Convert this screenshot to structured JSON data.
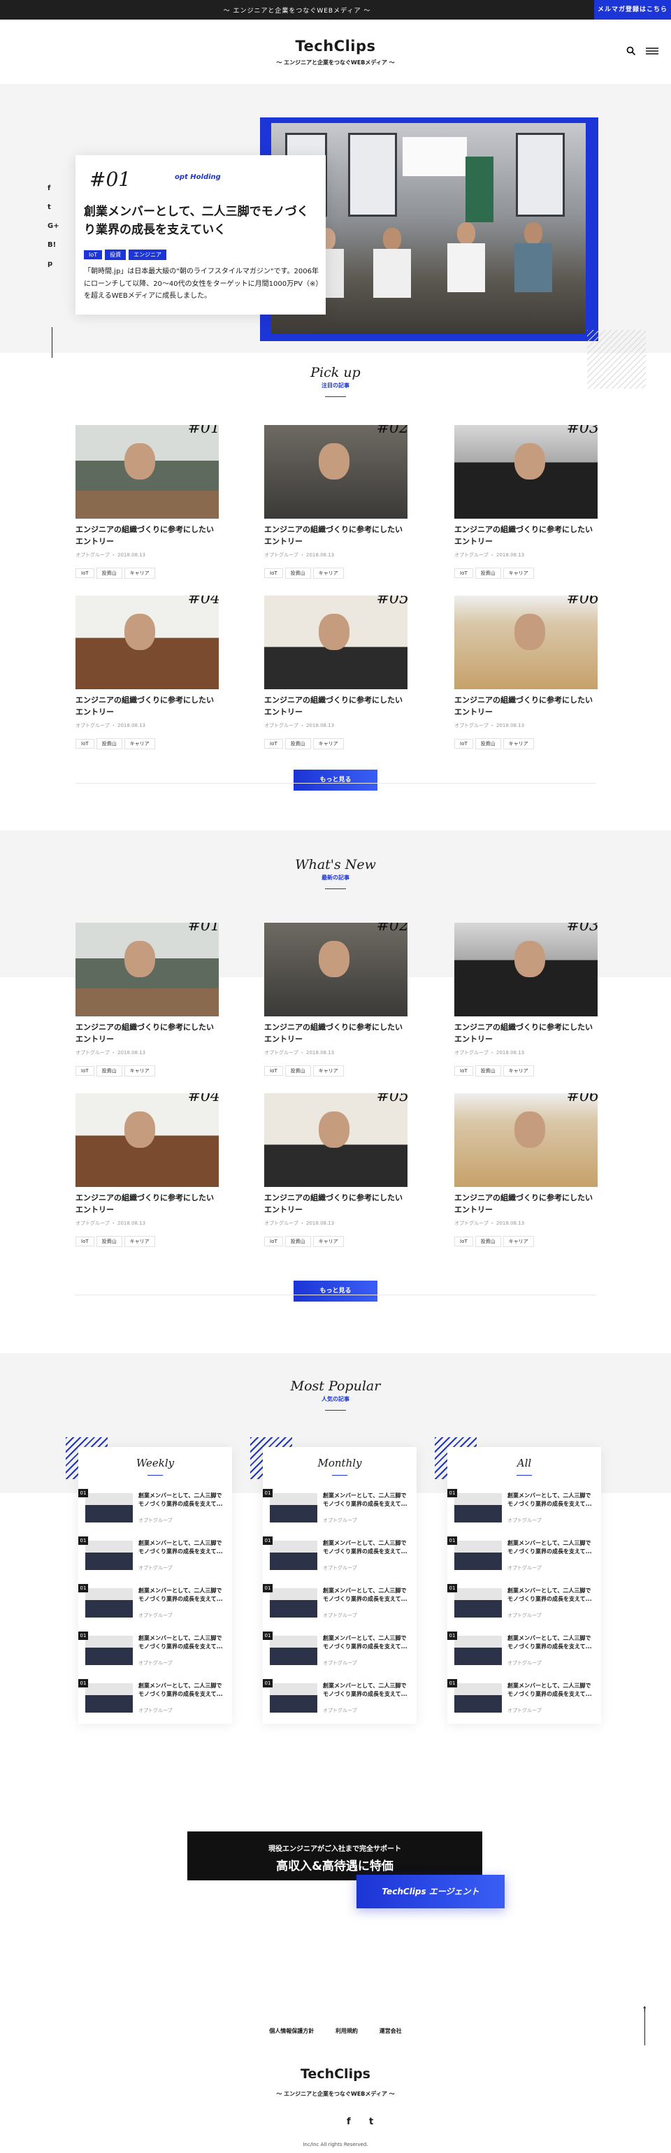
{
  "topbar": {
    "tagline": "〜 エンジニアと企業をつなぐWEBメディア 〜",
    "magazine_button": "メルマガ登録はこちら"
  },
  "header": {
    "logo": "TechClips",
    "logo_sub": "〜 エンジニアと企業をつなぐWEBメディア 〜",
    "icons": [
      "search-icon",
      "menu-icon"
    ]
  },
  "hero": {
    "number": "#01",
    "sponsor": "opt Holding",
    "title": "創業メンバーとして、二人三脚でモノづくり業界の成長を支えていく",
    "tags": [
      "IoT",
      "投資",
      "エンジニア"
    ],
    "description": "「朝時間.jp」は日本最大級の\"朝のライフスタイルマガジン\"です。2006年にローンチして以降、20～40代の女性をターゲットに月間1000万PV（※）を超えるWEBメディアに成長しました。",
    "social": [
      "f",
      "t",
      "G+",
      "B!",
      "p"
    ]
  },
  "pickup": {
    "title_en": "Pick up",
    "title_ja": "注目の記事",
    "more": "もっと見る"
  },
  "whatsnew": {
    "title_en": "What's New",
    "title_ja": "最新の記事",
    "more": "もっと見る"
  },
  "cards": [
    {
      "num": "#01",
      "title": "エンジニアの組織づくりに参考にしたいエントリー",
      "meta": "オプトグループ ・ 2018.08.13",
      "tags": [
        "IoT",
        "投資山",
        "キャリア"
      ]
    },
    {
      "num": "#02",
      "title": "エンジニアの組織づくりに参考にしたいエントリー",
      "meta": "オプトグループ ・ 2018.08.13",
      "tags": [
        "IoT",
        "投資山",
        "キャリア"
      ]
    },
    {
      "num": "#03",
      "title": "エンジニアの組織づくりに参考にしたいエントリー",
      "meta": "オプトグループ ・ 2018.08.13",
      "tags": [
        "IoT",
        "投資山",
        "キャリア"
      ]
    },
    {
      "num": "#04",
      "title": "エンジニアの組織づくりに参考にしたいエントリー",
      "meta": "オプトグループ ・ 2018.08.13",
      "tags": [
        "IoT",
        "投資山",
        "キャリア"
      ]
    },
    {
      "num": "#05",
      "title": "エンジニアの組織づくりに参考にしたいエントリー",
      "meta": "オプトグループ ・ 2018.08.13",
      "tags": [
        "IoT",
        "投資山",
        "キャリア"
      ]
    },
    {
      "num": "#06",
      "title": "エンジニアの組織づくりに参考にしたいエントリー",
      "meta": "オプトグループ ・ 2018.08.13",
      "tags": [
        "IoT",
        "投資山",
        "キャリア"
      ]
    }
  ],
  "popular": {
    "title_en": "Most Popular",
    "title_ja": "人気の記事",
    "columns": [
      "Weekly",
      "Monthly",
      "All"
    ],
    "item": {
      "rank": "01",
      "title": "創業メンバーとして、二人三脚でモノづくり業界の成長を支えて...",
      "meta": "オプトグループ"
    }
  },
  "cta": {
    "sub": "現役エンジニアがご入社まで完全サポート",
    "main": "高収入&高待遇に特価",
    "button": "TechClips エージェント"
  },
  "footer": {
    "links": [
      "個人情報保護方針",
      "利用規約",
      "運営会社"
    ],
    "logo": "TechClips",
    "logo_sub": "〜 エンジニアと企業をつなぐWEBメディア 〜",
    "social": [
      "f",
      "t"
    ],
    "copyright": "Inc/Inc All rights Reserved."
  },
  "colors": {
    "accent": "#1c35d6",
    "dark": "#1a1a1a",
    "band": "#f4f4f4"
  }
}
